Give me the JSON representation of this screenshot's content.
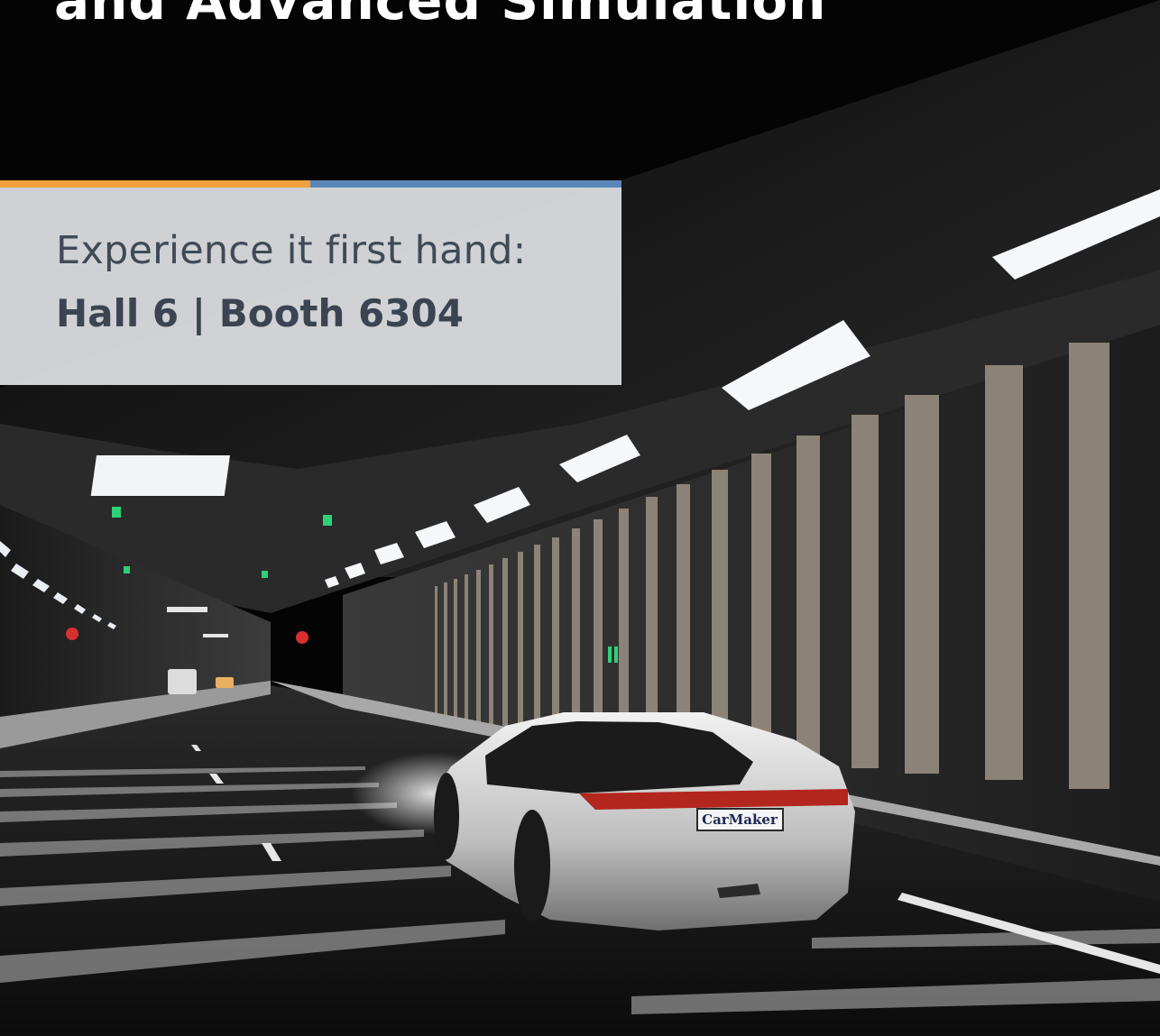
{
  "headline": "and Advanced Simulation",
  "info": {
    "line1": "Experience it first hand:",
    "line2": "Hall 6 | Booth 6304"
  },
  "car": {
    "plate_text": "CarMaker"
  },
  "colors": {
    "accent_orange": "#f0a13c",
    "accent_blue": "#5b86ba",
    "card_background": "#dadcdf",
    "card_text": "#404a56"
  }
}
